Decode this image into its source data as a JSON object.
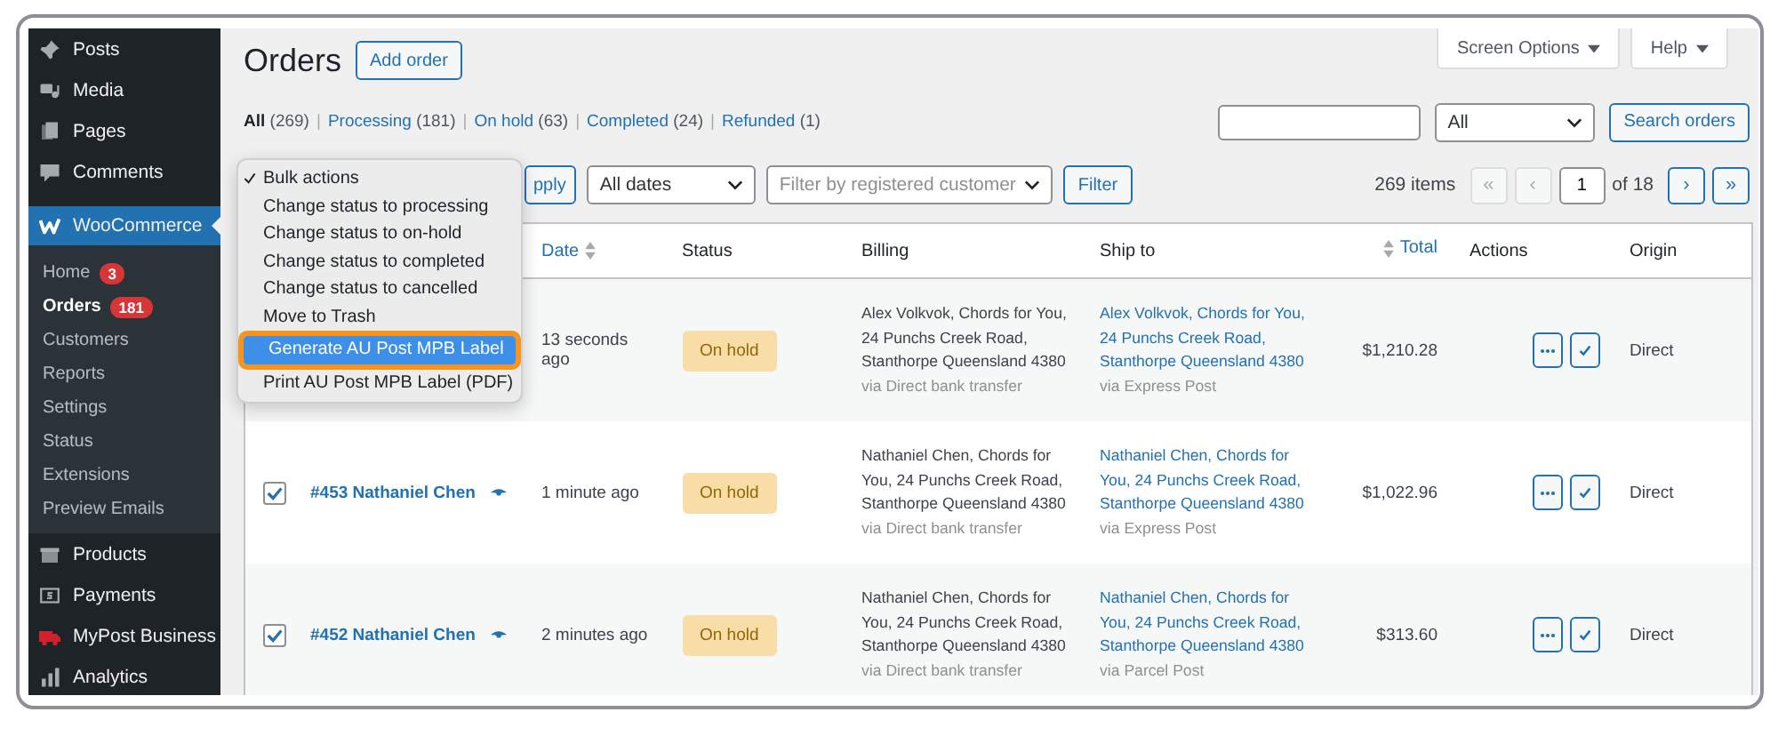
{
  "sidebar": {
    "items": [
      {
        "label": "Posts",
        "selected": false
      },
      {
        "label": "Media",
        "selected": false
      },
      {
        "label": "Pages",
        "selected": false
      },
      {
        "label": "Comments",
        "selected": false
      },
      {
        "label": "WooCommerce",
        "selected": true,
        "children": [
          {
            "label": "Home",
            "badge": "3",
            "selected": false
          },
          {
            "label": "Orders",
            "badge": "181",
            "selected": true
          },
          {
            "label": "Customers",
            "selected": false
          },
          {
            "label": "Reports",
            "selected": false
          },
          {
            "label": "Settings",
            "selected": false
          },
          {
            "label": "Status",
            "selected": false
          },
          {
            "label": "Extensions",
            "selected": false
          },
          {
            "label": "Preview Emails",
            "selected": false
          }
        ]
      },
      {
        "label": "Products",
        "selected": false
      },
      {
        "label": "Payments",
        "selected": false
      },
      {
        "label": "MyPost Business",
        "selected": false
      },
      {
        "label": "Analytics",
        "selected": false
      }
    ]
  },
  "header": {
    "title": "Orders",
    "add_button": "Add order",
    "tabs": [
      {
        "label": "Screen Options"
      },
      {
        "label": "Help"
      }
    ]
  },
  "status_filters": {
    "separator": "|",
    "items": [
      {
        "label": "All",
        "count": "(269)",
        "selected": true
      },
      {
        "label": "Processing",
        "count": "(181)",
        "selected": false
      },
      {
        "label": "On hold",
        "count": "(63)",
        "selected": false
      },
      {
        "label": "Completed",
        "count": "(24)",
        "selected": false
      },
      {
        "label": "Refunded",
        "count": "(1)",
        "selected": false
      }
    ]
  },
  "search": {
    "type_select": "All",
    "button": "Search orders"
  },
  "tablenav": {
    "apply_button": "pply",
    "date_select": "All dates",
    "customer_select": {
      "placeholder": "Filter by registered customer"
    },
    "filter_button": "Filter",
    "items_count": "269 items",
    "pagination": {
      "first": {
        "label": "«",
        "disabled": true
      },
      "prev": {
        "label": "‹",
        "disabled": true
      },
      "current_page": "1",
      "total_pages": "of 18",
      "next": {
        "label": "›",
        "disabled": false
      },
      "last": {
        "label": "»",
        "disabled": false
      }
    }
  },
  "bulk_actions_menu": {
    "options": [
      {
        "label": "Bulk actions",
        "selected": true,
        "highlighted": false
      },
      {
        "label": "Change status to processing",
        "selected": false,
        "highlighted": false
      },
      {
        "label": "Change status to on-hold",
        "selected": false,
        "highlighted": false
      },
      {
        "label": "Change status to completed",
        "selected": false,
        "highlighted": false
      },
      {
        "label": "Change status to cancelled",
        "selected": false,
        "highlighted": false
      },
      {
        "label": "Move to Trash",
        "selected": false,
        "highlighted": false
      },
      {
        "label": "Generate AU Post MPB Label",
        "selected": false,
        "highlighted": true
      },
      {
        "label": "Print AU Post MPB Label (PDF)",
        "selected": false,
        "highlighted": false
      }
    ]
  },
  "table": {
    "columns": [
      {
        "label": "Date",
        "sortable": true
      },
      {
        "label": "Status",
        "sortable": false
      },
      {
        "label": "Billing",
        "sortable": false
      },
      {
        "label": "Ship to",
        "sortable": false
      },
      {
        "label": "Total",
        "sortable": true
      },
      {
        "label": "Actions",
        "sortable": false
      },
      {
        "label": "Origin",
        "sortable": false
      }
    ],
    "rows": [
      {
        "date": "13 seconds ago",
        "status": "On hold",
        "billing": "Alex Volkvok, Chords for You, 24 Punchs Creek Road, Stanthorpe Queensland 4380",
        "billing_via": "via Direct bank transfer",
        "ship_to": "Alex Volkvok, Chords for You, 24 Punchs Creek Road, Stanthorpe Queensland 4380",
        "ship_via": "via Express Post",
        "total": "$1,210.28",
        "origin": "Direct"
      },
      {
        "selected": true,
        "order": "#453 Nathaniel Chen",
        "date": "1 minute ago",
        "status": "On hold",
        "billing": "Nathaniel Chen, Chords for You, 24 Punchs Creek Road, Stanthorpe Queensland 4380",
        "billing_via": "via Direct bank transfer",
        "ship_to": "Nathaniel Chen, Chords for You, 24 Punchs Creek Road, Stanthorpe Queensland 4380",
        "ship_via": "via Express Post",
        "total": "$1,022.96",
        "origin": "Direct"
      },
      {
        "selected": true,
        "order": "#452 Nathaniel Chen",
        "date": "2 minutes ago",
        "status": "On hold",
        "billing": "Nathaniel Chen, Chords for You, 24 Punchs Creek Road, Stanthorpe Queensland 4380",
        "billing_via": "via Direct bank transfer",
        "ship_to": "Nathaniel Chen, Chords for You, 24 Punchs Creek Road, Stanthorpe Queensland 4380",
        "ship_via": "via Parcel Post",
        "total": "$313.60",
        "origin": "Direct"
      }
    ]
  }
}
